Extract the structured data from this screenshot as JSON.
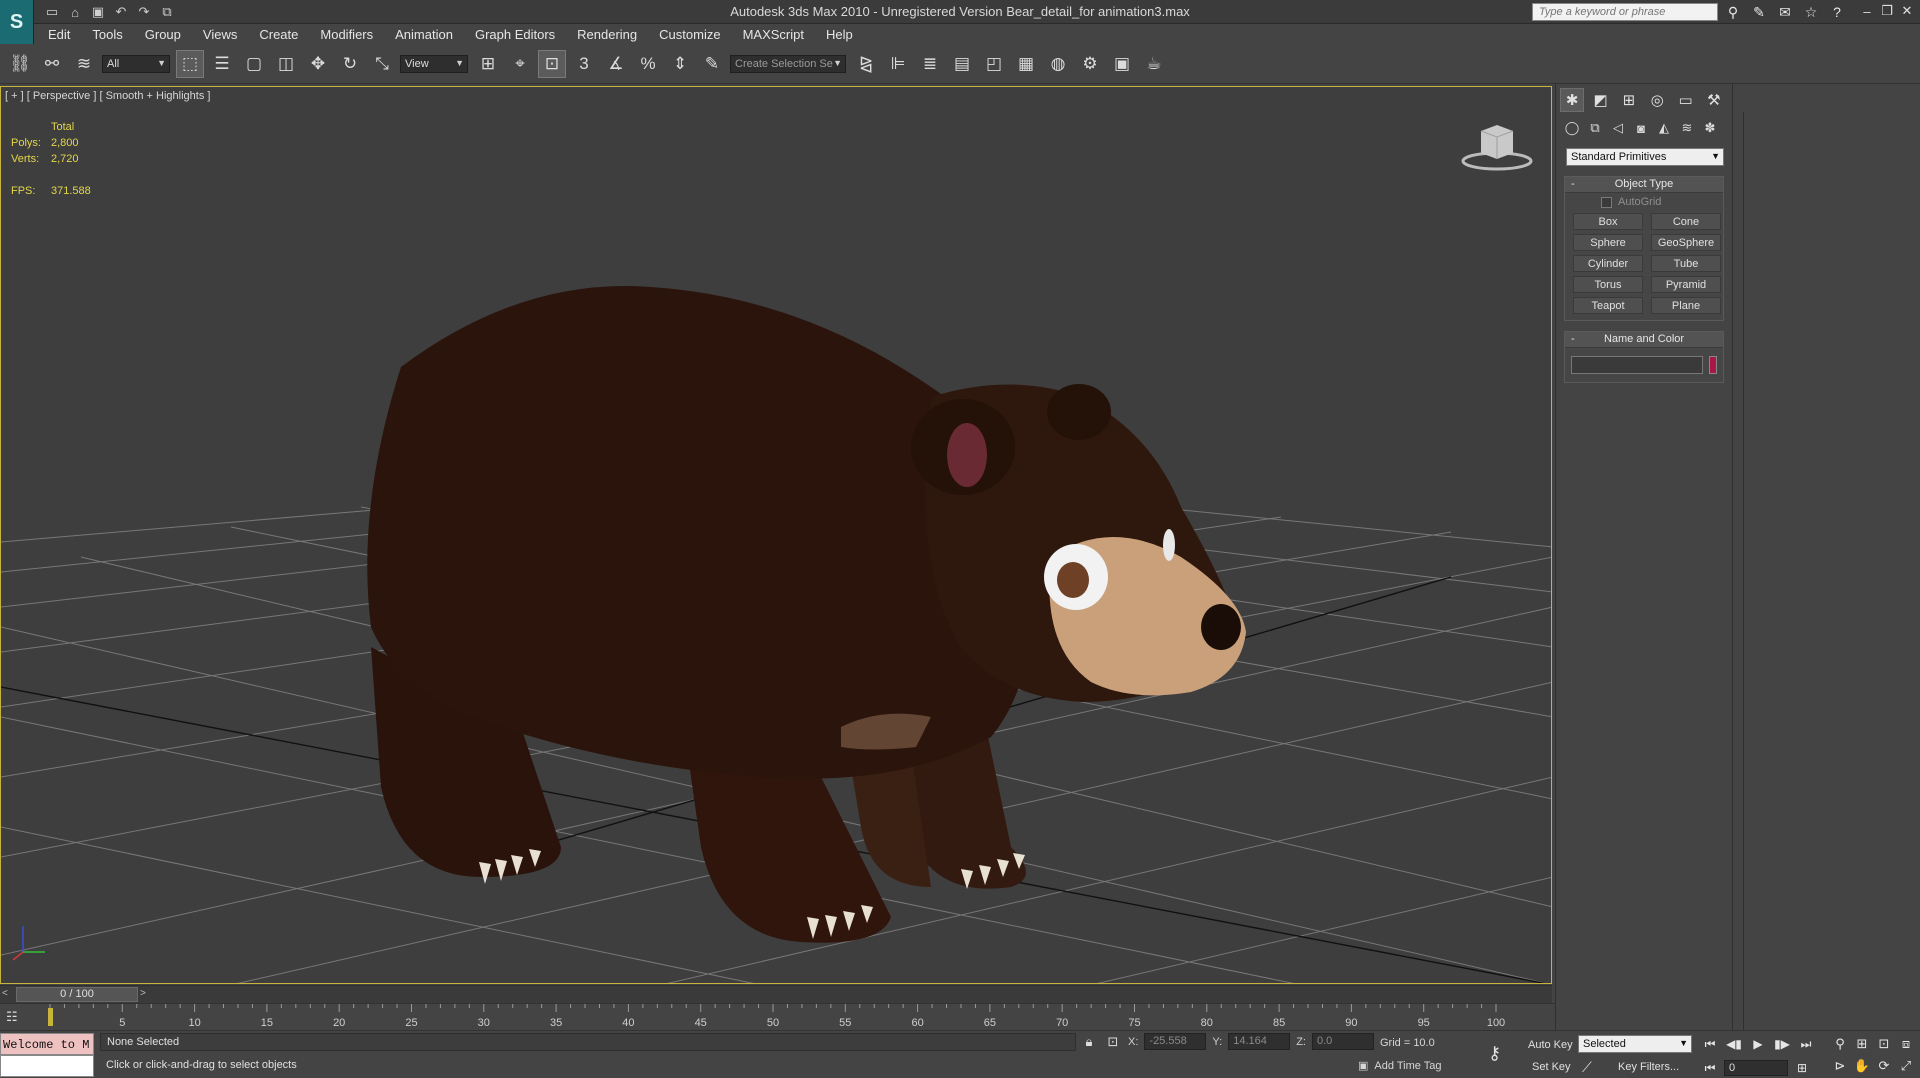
{
  "titlebar": {
    "title": "Autodesk 3ds Max  2010    - Unregistered Version      Bear_detail_for animation3.max",
    "search_placeholder": "Type a keyword or phrase",
    "quick_access": [
      "new-icon",
      "open-icon",
      "save-icon",
      "undo-icon",
      "redo-icon",
      "project-icon"
    ]
  },
  "menu": [
    "Edit",
    "Tools",
    "Group",
    "Views",
    "Create",
    "Modifiers",
    "Animation",
    "Graph Editors",
    "Rendering",
    "Customize",
    "MAXScript",
    "Help"
  ],
  "toolbar": {
    "selection_filter": "All",
    "reference_coord": "View",
    "named_selection": "Create Selection Se",
    "snap_label": "3"
  },
  "viewport": {
    "label": "[ + ] [ Perspective ] [ Smooth + Highlights ]",
    "stats": {
      "header": "Total",
      "polys_label": "Polys:",
      "polys": "2,800",
      "verts_label": "Verts:",
      "verts": "2,720",
      "fps_label": "FPS:",
      "fps": "371.588"
    }
  },
  "command_panel": {
    "category": "Standard Primitives",
    "object_type_title": "Object Type",
    "autogrid": "AutoGrid",
    "primitives": [
      "Box",
      "Cone",
      "Sphere",
      "GeoSphere",
      "Cylinder",
      "Tube",
      "Torus",
      "Pyramid",
      "Teapot",
      "Plane"
    ],
    "name_color_title": "Name and Color",
    "object_color": "#a8164a"
  },
  "timeline": {
    "position": "0 / 100",
    "ticks": [
      "5",
      "10",
      "15",
      "20",
      "25",
      "30",
      "35",
      "40",
      "45",
      "50",
      "55",
      "60",
      "65",
      "70",
      "75",
      "80",
      "85",
      "90",
      "95",
      "100"
    ]
  },
  "status": {
    "listener": "Welcome to M",
    "selection": "None Selected",
    "prompt": "Click or click-and-drag to select objects",
    "x_label": "X:",
    "x": "-25.558",
    "y_label": "Y:",
    "y": "14.164",
    "z_label": "Z:",
    "z": "0.0",
    "grid": "Grid = 10.0",
    "add_time_tag": "Add Time Tag",
    "auto_key": "Auto Key",
    "set_key": "Set Key",
    "selected": "Selected",
    "key_filters": "Key Filters...",
    "frame": "0"
  }
}
